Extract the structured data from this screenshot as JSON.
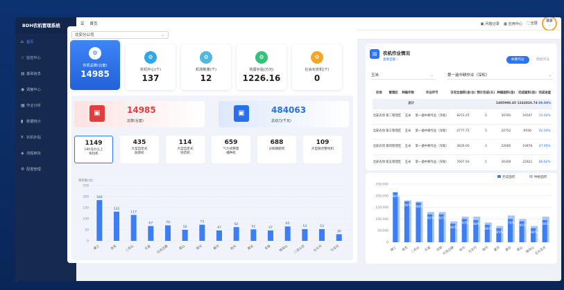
{
  "app": {
    "title": "BDH农机管理系统"
  },
  "topbar": {
    "home": "首页",
    "items": [
      "问题记录",
      "应用中心",
      "全屏"
    ],
    "avatar_value": "88",
    "avatar_unit": "%"
  },
  "tabs": [
    {
      "label": "● 首页 ×",
      "active": true
    },
    {
      "label": "应用中心",
      "active": false
    }
  ],
  "sidebar": {
    "items": [
      {
        "label": "首页",
        "icon": "home-icon",
        "active": true,
        "arrow": ""
      },
      {
        "label": "监控中心",
        "icon": "star-icon",
        "active": false,
        "arrow": ""
      },
      {
        "label": "基础信息",
        "icon": "doc-icon",
        "active": false,
        "arrow": "⌄"
      },
      {
        "label": "调度中心",
        "icon": "dispatch-icon",
        "active": false,
        "arrow": "⌄"
      },
      {
        "label": "作业分析",
        "icon": "analysis-icon",
        "active": false,
        "arrow": "⌄"
      },
      {
        "label": "数据统计",
        "icon": "bar-chart-icon",
        "active": false,
        "arrow": "⌄"
      },
      {
        "label": "农机补贴",
        "icon": "yen-icon",
        "active": false,
        "arrow": "⌄"
      },
      {
        "label": "流程审批",
        "icon": "approval-icon",
        "active": false,
        "arrow": "⌄"
      },
      {
        "label": "配置管理",
        "icon": "gear-icon",
        "active": false,
        "arrow": "⌄"
      }
    ]
  },
  "filter": {
    "company": "北安分公司"
  },
  "cards": [
    {
      "label": "农机总数(台套)",
      "value": "14985",
      "color": "#2a6ee8"
    },
    {
      "label": "农机中心(个)",
      "value": "137",
      "color": "#2fa7e8"
    },
    {
      "label": "机场数量(个)",
      "value": "12",
      "color": "#4fb7e0"
    },
    {
      "label": "购置补贴(万元)",
      "value": "1226.16",
      "color": "#35c07c"
    },
    {
      "label": "社会化农机(个)",
      "value": "0",
      "color": "#f5a623"
    }
  ],
  "banners": [
    {
      "value": "14985",
      "label": "总数(台套)",
      "color": "#e03e3e"
    },
    {
      "value": "484063",
      "label": "总动力(千瓦)",
      "color": "#2a6ee8"
    }
  ],
  "stats": [
    {
      "value": "1149",
      "label": "180马力以上\n拖拉机"
    },
    {
      "value": "435",
      "label": "大型自走式\n收获机"
    },
    {
      "value": "114",
      "label": "大型自走式\n喷药机"
    },
    {
      "value": "659",
      "label": "气力式精量\n播种机"
    },
    {
      "value": "688",
      "label": "分厢施肥机"
    },
    {
      "value": "109",
      "label": "大型联合整地机"
    }
  ],
  "chart_data": [
    {
      "type": "bar",
      "ylabel": "保有数(台)",
      "ylim": [
        0,
        250
      ],
      "yticks": [
        0,
        50,
        100,
        150,
        200,
        250
      ],
      "categories": [
        "嫩江",
        "逊克",
        "二龙山",
        "红星",
        "红色边疆",
        "尾山",
        "锦河",
        "襄河",
        "赵光",
        "建设",
        "龙镇",
        "格球山",
        "二龙山农",
        "长水河",
        "引龙河"
      ],
      "values": [
        184,
        132,
        117,
        67,
        70,
        50,
        73,
        47,
        62,
        52,
        47,
        65,
        53,
        53,
        30
      ]
    },
    {
      "type": "bar",
      "ylim": [
        0,
        250000
      ],
      "yticks": [
        "0",
        "50,000",
        "100,000",
        "150,000",
        "200,000",
        "250,000"
      ],
      "categories": [
        "嫩江",
        "逊克",
        "二龙山",
        "红星",
        "龙镇",
        "红色边疆",
        "赵光",
        "引龙河",
        "锦河",
        "襄河",
        "建设",
        "尾山",
        "格球山",
        "五大连池"
      ],
      "series": [
        {
          "name": "完成面积",
          "values": [
            215000,
            175000,
            170000,
            120000,
            120000,
            80000,
            100000,
            95000,
            75000,
            60000,
            100000,
            90000,
            60000,
            95000
          ]
        },
        {
          "name": "种植面积",
          "values": [
            200000,
            180000,
            175000,
            130000,
            130000,
            90000,
            110000,
            110000,
            85000,
            70000,
            115000,
            100000,
            70000,
            110000
          ]
        }
      ],
      "labels": [
        "84%",
        "90%",
        "98%",
        "92%",
        "92%",
        "86%",
        "93%",
        "88%",
        "90%",
        "85%",
        "78%",
        "95%",
        "84%",
        "96%",
        "92%"
      ]
    }
  ],
  "work": {
    "title": "农机作业情况",
    "link": "查看全部 ›",
    "tabs": [
      {
        "label": "本期作业",
        "active": true
      },
      {
        "label": "调度作业",
        "active": false
      }
    ],
    "crop": "玉米",
    "task": "第一遍中耕作业（深松）",
    "headers": [
      "农场",
      "管理区",
      "种植作物",
      "作业环节",
      "日完全面积(亩/台)",
      "预计完成(天)",
      "种植面积(亩)",
      "完成面积(亩)",
      "完成进度"
    ],
    "total": {
      "label": "总计",
      "plant": "1485998.45",
      "done": "1243826.74",
      "pct": "88.88%"
    },
    "rows": [
      [
        "北安农场",
        "第二管理区",
        "玉米",
        "第一遍中耕作业（深松）",
        "8253.25",
        "2",
        "30783",
        "16507",
        "53.60%"
      ],
      [
        "北安农场",
        "第三管理区",
        "玉米",
        "第一遍中耕作业（深松）",
        "4777.75",
        "3",
        "22752",
        "9556",
        "42.00%"
      ],
      [
        "北安农场",
        "第四管理区",
        "玉米",
        "第一遍中耕作业（深松）",
        "3626.00",
        "3",
        "22685",
        "10878",
        "47.95%"
      ],
      [
        "北安农场",
        "第五管理区",
        "玉米",
        "第一遍中耕作业（深松）",
        "7607.50",
        "1",
        "26309",
        "22822",
        "86.62%"
      ]
    ]
  },
  "colors": {
    "primary": "#2a74f5",
    "bar": "#3d7ef5",
    "sidebar": "#152a4e"
  }
}
